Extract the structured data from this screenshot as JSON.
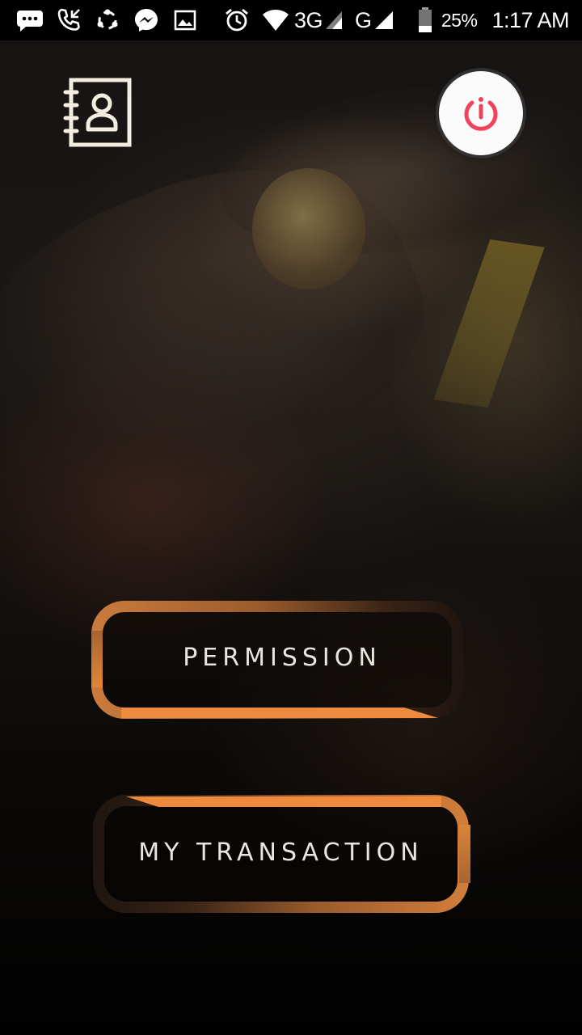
{
  "status_bar": {
    "network_label": "3G",
    "network2_label": "G",
    "battery": "25%",
    "time": "1:17 AM",
    "icons": [
      "message-icon",
      "call-icon",
      "sync-icon",
      "messenger-icon",
      "image-icon",
      "alarm-icon",
      "wifi-icon",
      "signal-icon",
      "signal-icon",
      "battery-icon"
    ]
  },
  "header": {
    "contacts_icon": "contact-book-icon",
    "power_icon": "power-icon"
  },
  "menu": {
    "permission_label": "PERMISSION",
    "transaction_label": "MY TRANSACTION"
  },
  "colors": {
    "accent_orange": "#e8843a",
    "power_red": "#f0445c",
    "text_light": "#e9e6e2"
  }
}
